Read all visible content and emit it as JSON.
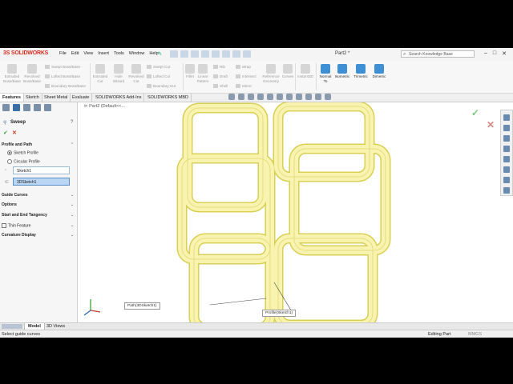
{
  "app": {
    "logo": "SOLIDWORKS",
    "menu": [
      "File",
      "Edit",
      "View",
      "Insert",
      "Tools",
      "Window",
      "Help"
    ],
    "doc_title": "Part2 *",
    "search_placeholder": "Search Knowledge Base"
  },
  "ribbon": {
    "big": [
      {
        "label": "Extruded\nBoss/Base",
        "icon": "extruded-boss-icon"
      },
      {
        "label": "Revolved\nBoss/Base",
        "icon": "revolved-boss-icon"
      },
      {
        "label": "Extruded\nCut",
        "icon": "extruded-cut-icon"
      },
      {
        "label": "Hole\nWizard",
        "icon": "hole-wizard-icon"
      },
      {
        "label": "Revolved\nCut",
        "icon": "revolved-cut-icon"
      },
      {
        "label": "Fillet",
        "icon": "fillet-icon"
      },
      {
        "label": "Linear\nPattern",
        "icon": "linear-pattern-icon"
      },
      {
        "label": "Reference\nGeometry",
        "icon": "reference-geometry-icon"
      },
      {
        "label": "Curves",
        "icon": "curves-icon"
      },
      {
        "label": "Instant3D",
        "icon": "instant3d-icon"
      }
    ],
    "small": [
      "Swept Boss/Base",
      "Lofted Boss/Base",
      "Boundary Boss/Base",
      "Swept Cut",
      "Lofted Cut",
      "Boundary Cut",
      "Rib",
      "Draft",
      "Shell",
      "Wrap",
      "Intersect",
      "Mirror"
    ],
    "views": [
      "Normal\nTo",
      "Isometric",
      "Trimetric",
      "Dimetric"
    ]
  },
  "tabs": [
    "Features",
    "Sketch",
    "Sheet Metal",
    "Evaluate",
    "SOLIDWORKS Add-Ins",
    "SOLIDWORKS MBD"
  ],
  "tree_node": "Part2  (Default<<...",
  "property_manager": {
    "title": "Sweep",
    "profile_and_path": "Profile and Path",
    "sketch_profile": "Sketch Profile",
    "circular_profile": "Circular Profile",
    "profile_value": "Sketch1",
    "path_value": "3DSketch1",
    "guide_curves": "Guide Curves",
    "options": "Options",
    "start_end_tangency": "Start and End Tangency",
    "thin_feature": "Thin Feature",
    "curvature_display": "Curvature Display"
  },
  "callouts": {
    "path": "Path(3DSketch1)",
    "profile": "Profile(Sketch1)"
  },
  "bottom_tabs": [
    "Model",
    "3D Views"
  ],
  "status": {
    "left": "Select guide curves",
    "mode": "Editing Part",
    "units": "MMGS"
  },
  "colors": {
    "tube": "#f8f4b0",
    "tube_edge": "#d8cf55",
    "accent": "#3a6ea5"
  }
}
